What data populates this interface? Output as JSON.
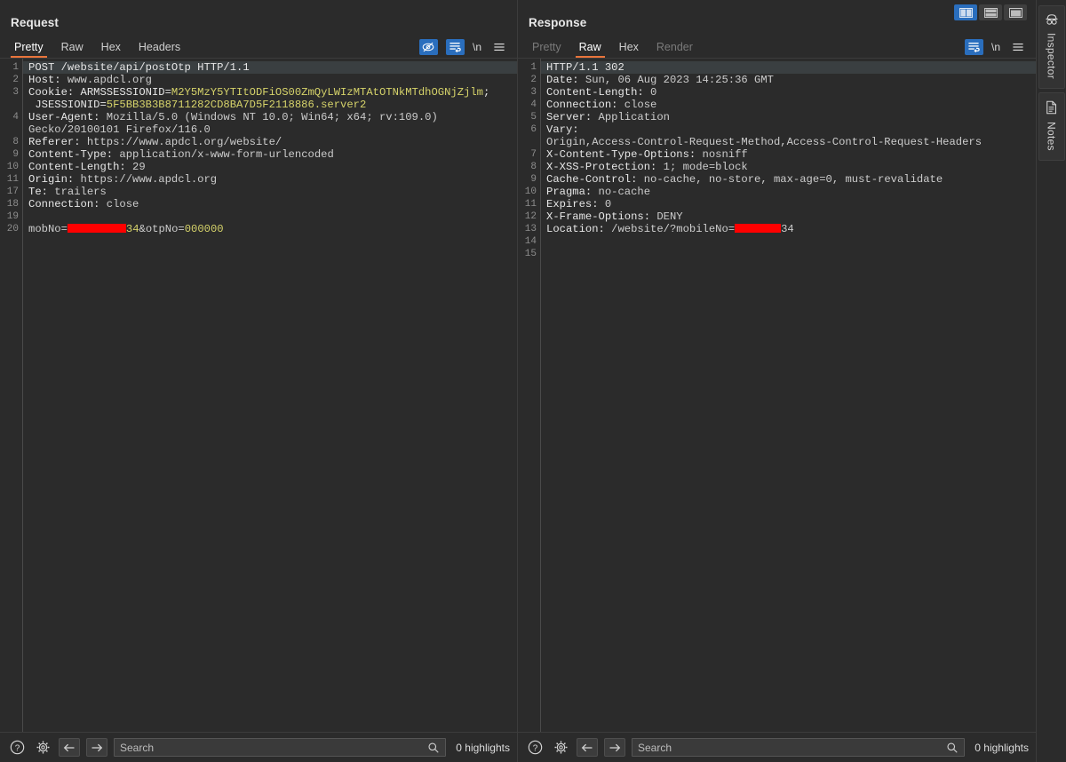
{
  "layout": {
    "toggles": [
      {
        "name": "vertical-split",
        "active": true
      },
      {
        "name": "horizontal-split",
        "active": false
      },
      {
        "name": "single-pane",
        "active": false
      }
    ]
  },
  "request": {
    "title": "Request",
    "tabs": [
      {
        "label": "Pretty",
        "active": true,
        "disabled": false
      },
      {
        "label": "Raw",
        "active": false,
        "disabled": false
      },
      {
        "label": "Hex",
        "active": false,
        "disabled": false
      },
      {
        "label": "Headers",
        "active": false,
        "disabled": false
      }
    ],
    "tools": [
      {
        "name": "hide-icon",
        "active": true
      },
      {
        "name": "word-wrap-icon",
        "active": true
      },
      {
        "name": "newline-icon",
        "label": "\\n",
        "active": false
      },
      {
        "name": "menu-icon",
        "active": false
      }
    ],
    "lines": [
      {
        "num": "1",
        "current": true,
        "segs": [
          {
            "t": "POST /website/api/postOtp HTTP/1.1",
            "c": "k"
          }
        ]
      },
      {
        "num": "2",
        "segs": [
          {
            "t": "Host: ",
            "c": "k"
          },
          {
            "t": "www.apdcl.org",
            "c": "plain"
          }
        ]
      },
      {
        "num": "3",
        "segs": [
          {
            "t": "Cookie: ARMSSESSIONID=",
            "c": "k"
          },
          {
            "t": "M2Y5MzY5YTItODFiOS00ZmQyLWIzMTAtOTNkMTdhOGNjZjlm",
            "c": "v"
          },
          {
            "t": ";",
            "c": "k"
          }
        ]
      },
      {
        "num": "",
        "segs": [
          {
            "t": " JSESSIONID=",
            "c": "k"
          },
          {
            "t": "5F5BB3B3B8711282CD8BA7D5F2118886.server2",
            "c": "v"
          }
        ]
      },
      {
        "num": "4",
        "segs": [
          {
            "t": "User-Agent: ",
            "c": "k"
          },
          {
            "t": "Mozilla/5.0 (Windows NT 10.0; Win64; x64; rv:109.0)",
            "c": "plain"
          }
        ]
      },
      {
        "num": "",
        "segs": [
          {
            "t": "Gecko/20100101 Firefox/116.0",
            "c": "plain"
          }
        ]
      },
      {
        "num": "8",
        "segs": [
          {
            "t": "Referer: ",
            "c": "k"
          },
          {
            "t": "https://www.apdcl.org/website/",
            "c": "plain"
          }
        ]
      },
      {
        "num": "9",
        "segs": [
          {
            "t": "Content-Type: ",
            "c": "k"
          },
          {
            "t": "application/x-www-form-urlencoded",
            "c": "plain"
          }
        ]
      },
      {
        "num": "10",
        "segs": [
          {
            "t": "Content-Length: ",
            "c": "k"
          },
          {
            "t": "29",
            "c": "plain"
          }
        ]
      },
      {
        "num": "11",
        "segs": [
          {
            "t": "Origin: ",
            "c": "k"
          },
          {
            "t": "https://www.apdcl.org",
            "c": "plain"
          }
        ]
      },
      {
        "num": "17",
        "segs": [
          {
            "t": "Te: ",
            "c": "k"
          },
          {
            "t": "trailers",
            "c": "plain"
          }
        ]
      },
      {
        "num": "18",
        "segs": [
          {
            "t": "Connection: ",
            "c": "k"
          },
          {
            "t": "close",
            "c": "plain"
          }
        ]
      },
      {
        "num": "19",
        "segs": []
      },
      {
        "num": "20",
        "segs": [
          {
            "t": "mobNo=",
            "c": "plain"
          },
          {
            "redact": 66
          },
          {
            "t": "34",
            "c": "v"
          },
          {
            "t": "&otpNo=",
            "c": "plain"
          },
          {
            "t": "000000",
            "c": "v"
          }
        ]
      }
    ],
    "status": {
      "search_placeholder": "Search",
      "search_value": "",
      "highlights": "0 highlights"
    }
  },
  "response": {
    "title": "Response",
    "tabs": [
      {
        "label": "Pretty",
        "active": false,
        "disabled": true
      },
      {
        "label": "Raw",
        "active": true,
        "disabled": false
      },
      {
        "label": "Hex",
        "active": false,
        "disabled": false
      },
      {
        "label": "Render",
        "active": false,
        "disabled": true
      }
    ],
    "tools": [
      {
        "name": "word-wrap-icon",
        "active": true
      },
      {
        "name": "newline-icon",
        "label": "\\n",
        "active": false
      },
      {
        "name": "menu-icon",
        "active": false
      }
    ],
    "lines": [
      {
        "num": "1",
        "current": true,
        "segs": [
          {
            "t": "HTTP/1.1 302",
            "c": "k"
          }
        ]
      },
      {
        "num": "2",
        "segs": [
          {
            "t": "Date: ",
            "c": "k"
          },
          {
            "t": "Sun, 06 Aug 2023 14:25:36 GMT",
            "c": "plain"
          }
        ]
      },
      {
        "num": "3",
        "segs": [
          {
            "t": "Content-Length: ",
            "c": "k"
          },
          {
            "t": "0",
            "c": "plain"
          }
        ]
      },
      {
        "num": "4",
        "segs": [
          {
            "t": "Connection: ",
            "c": "k"
          },
          {
            "t": "close",
            "c": "plain"
          }
        ]
      },
      {
        "num": "5",
        "segs": [
          {
            "t": "Server: ",
            "c": "k"
          },
          {
            "t": "Application",
            "c": "plain"
          }
        ]
      },
      {
        "num": "6",
        "segs": [
          {
            "t": "Vary:",
            "c": "k"
          }
        ]
      },
      {
        "num": "",
        "segs": [
          {
            "t": "Origin,Access-Control-Request-Method,Access-Control-Request-Headers",
            "c": "plain"
          }
        ]
      },
      {
        "num": "7",
        "segs": [
          {
            "t": "X-Content-Type-Options: ",
            "c": "k"
          },
          {
            "t": "nosniff",
            "c": "plain"
          }
        ]
      },
      {
        "num": "8",
        "segs": [
          {
            "t": "X-XSS-Protection: ",
            "c": "k"
          },
          {
            "t": "1; mode=block",
            "c": "plain"
          }
        ]
      },
      {
        "num": "9",
        "segs": [
          {
            "t": "Cache-Control: ",
            "c": "k"
          },
          {
            "t": "no-cache, no-store, max-age=0, must-revalidate",
            "c": "plain"
          }
        ]
      },
      {
        "num": "10",
        "segs": [
          {
            "t": "Pragma: ",
            "c": "k"
          },
          {
            "t": "no-cache",
            "c": "plain"
          }
        ]
      },
      {
        "num": "11",
        "segs": [
          {
            "t": "Expires: ",
            "c": "k"
          },
          {
            "t": "0",
            "c": "plain"
          }
        ]
      },
      {
        "num": "12",
        "segs": [
          {
            "t": "X-Frame-Options: ",
            "c": "k"
          },
          {
            "t": "DENY",
            "c": "plain"
          }
        ]
      },
      {
        "num": "13",
        "segs": [
          {
            "t": "Location: ",
            "c": "k"
          },
          {
            "t": "/website/?mobileNo=",
            "c": "plain"
          },
          {
            "redact": 52
          },
          {
            "t": "34",
            "c": "plain"
          }
        ]
      },
      {
        "num": "14",
        "segs": []
      },
      {
        "num": "15",
        "segs": []
      }
    ],
    "status": {
      "search_placeholder": "Search",
      "search_value": "",
      "highlights": "0 highlights"
    }
  },
  "sidebar": {
    "items": [
      {
        "label": "Inspector",
        "icon": "inspector-icon"
      },
      {
        "label": "Notes",
        "icon": "notes-icon"
      }
    ]
  },
  "colors": {
    "accent_orange": "#e8743b",
    "accent_blue": "#2a6ebd",
    "value_yellow": "#d6d36a",
    "redaction_red": "#ff0000",
    "background": "#2b2b2b"
  }
}
